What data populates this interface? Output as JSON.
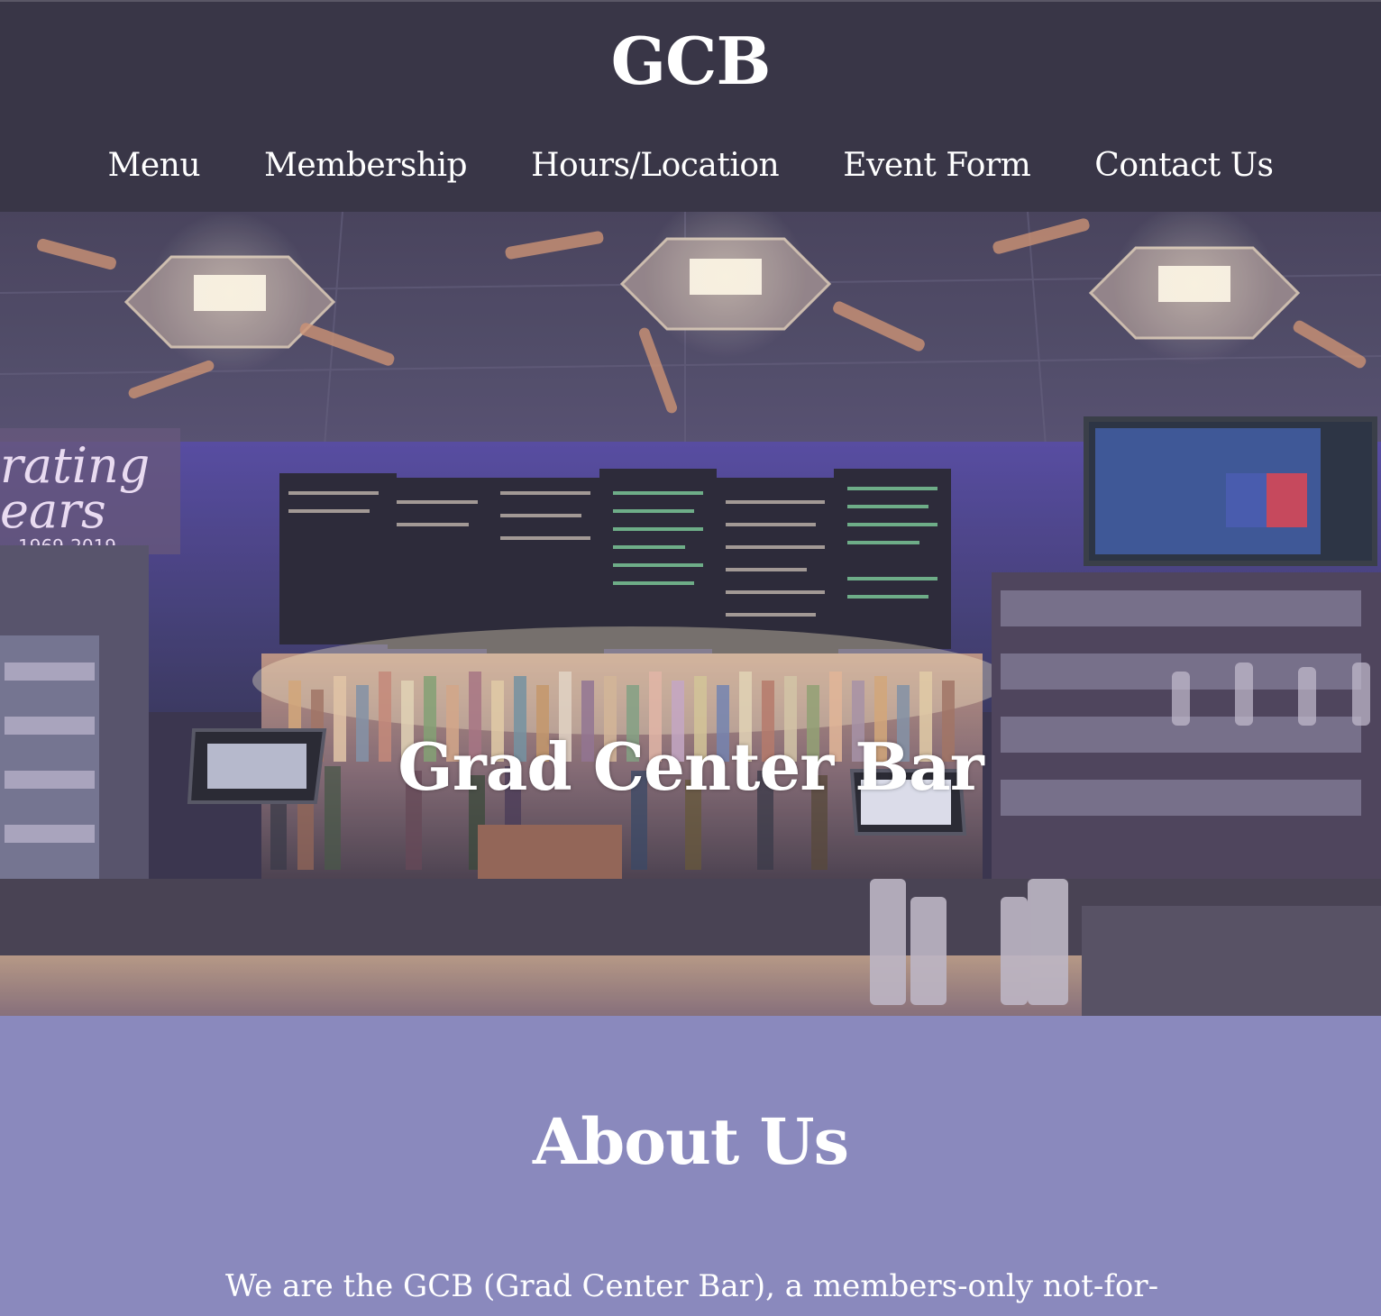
{
  "header": {
    "title": "GCB"
  },
  "nav": {
    "items": [
      {
        "label": "Menu"
      },
      {
        "label": "Membership"
      },
      {
        "label": "Hours/Location"
      },
      {
        "label": "Event Form"
      },
      {
        "label": "Contact Us"
      }
    ]
  },
  "hero": {
    "title": "Grad Center Bar",
    "image": "bar-interior-photo"
  },
  "about": {
    "heading": "About Us",
    "text": "We are the GCB (Grad Center Bar), a members-only not-for-"
  },
  "colors": {
    "header_bg": "#393647",
    "about_bg": "#8a89bd",
    "text": "#ffffff"
  }
}
